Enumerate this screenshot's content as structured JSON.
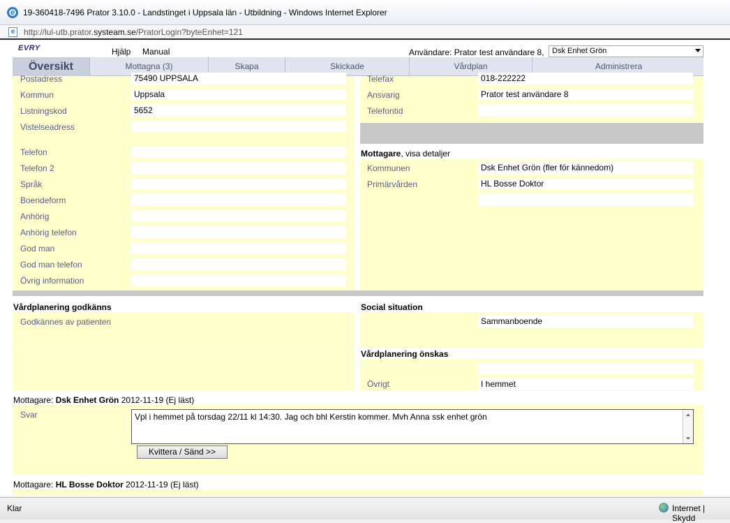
{
  "window": {
    "title": "19-360418-7496  Prator 3.10.0 - Landstinget i Uppsala län - Utbildning - Windows Internet Explorer",
    "url_prefix": "http://lul-utb.prator.",
    "url_host": "systeam.se",
    "url_suffix": "/PratorLogin?byteEnhet=121"
  },
  "topbar": {
    "logo": "EVRY",
    "help": "Hjälp",
    "manual": "Manual",
    "user_label": "Användare: Prator test användare 8,",
    "unit_selected": "Dsk Enhet Grön"
  },
  "tabs": [
    {
      "label": "Översikt"
    },
    {
      "label": "Mottagna (3)"
    },
    {
      "label": "Skapa"
    },
    {
      "label": "Skickade"
    },
    {
      "label": "Vårdplan"
    },
    {
      "label": "Administrera"
    }
  ],
  "patient": {
    "postadress_label": "Postadress",
    "postadress": "75490  UPPSALA",
    "kommun_label": "Kommun",
    "kommun": "Uppsala",
    "listningskod_label": "Listningskod",
    "listningskod": "5652",
    "vistelseadress_label": "Vistelseadress",
    "vistelseadress": "",
    "telefon_label": "Telefon",
    "telefon": "",
    "telefon2_label": "Telefon 2",
    "telefon2": "",
    "sprak_label": "Språk",
    "sprak": "",
    "boendeform_label": "Boendeform",
    "boendeform": "",
    "anhorig_label": "Anhörig",
    "anhorig": "",
    "anhorig_telefon_label": "Anhörig telefon",
    "anhorig_telefon": "",
    "god_man_label": "God man",
    "god_man": "",
    "god_man_telefon_label": "God man telefon",
    "god_man_telefon": "",
    "ovrig_information_label": "Övrig information",
    "ovrig_information": ""
  },
  "sender": {
    "telefax_label": "Telefax",
    "telefax": "018-222222",
    "ansvarig_label": "Ansvarig",
    "ansvarig": "Prator test användare 8",
    "telefontid_label": "Telefontid",
    "telefontid": ""
  },
  "mottagare": {
    "header_bold": "Mottagare",
    "header_rest": ", visa detaljer",
    "kommunen_label": "Kommunen",
    "kommunen": "Dsk Enhet Grön (fler för kännedom)",
    "primarvarden_label": "Primärvården",
    "primarvarden": "HL Bosse Doktor",
    "extra": ""
  },
  "vardplanering_godkanns": {
    "header": "Vårdplanering godkänns",
    "godkannes_label": "Godkännes av patienten"
  },
  "social": {
    "header": "Social situation",
    "value": "Sammanboende"
  },
  "vardplanering_onskas": {
    "header": "Vårdplanering önskas",
    "value1": "",
    "ovrigt_label": "Övrigt",
    "ovrigt": "I hemmet"
  },
  "reply1": {
    "prefix": "Mottagare: ",
    "name": "Dsk Enhet Grön",
    "meta": " 2012-11-19  (Ej läst)",
    "svar_label": "Svar",
    "svar_text": "Vpl i hemmet på torsdag 22/11 kl 14:30. Jag och bhl Kerstin kommer. Mvh Anna ssk enhet grön",
    "button": "Kvittera / Sänd >>"
  },
  "reply2": {
    "prefix": "Mottagare: ",
    "name": "HL Bosse Doktor",
    "meta": " 2012-11-19  (Ej läst)"
  },
  "statusbar": {
    "status": "Klar",
    "zone": "Internet | Skydd"
  }
}
